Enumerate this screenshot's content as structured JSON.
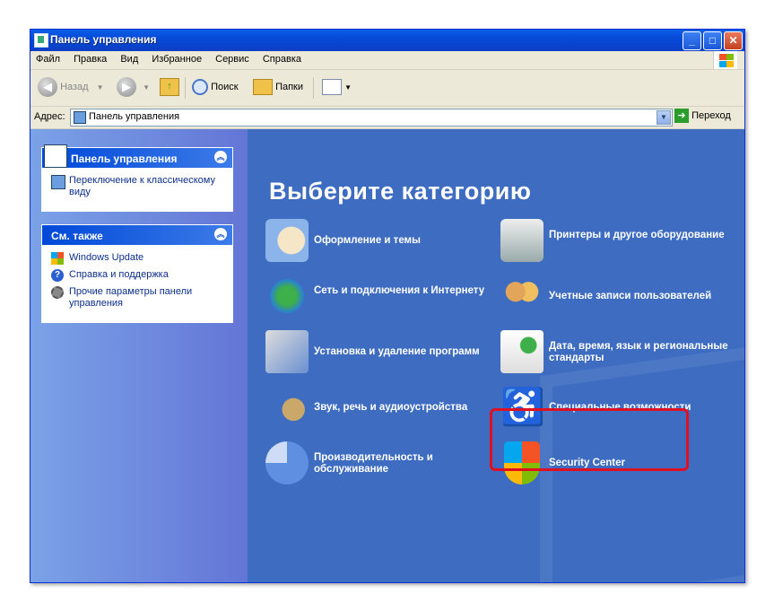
{
  "window": {
    "title": "Панель управления"
  },
  "menu": [
    "Файл",
    "Правка",
    "Вид",
    "Избранное",
    "Сервис",
    "Справка"
  ],
  "toolbar": {
    "back": "Назад",
    "search": "Поиск",
    "folders": "Папки"
  },
  "address": {
    "label": "Адрес:",
    "value": "Панель управления",
    "go": "Переход"
  },
  "left": {
    "panel1": {
      "title": "Панель управления",
      "items": [
        "Переключение к классическому виду"
      ]
    },
    "panel2": {
      "title": "См. также",
      "items": [
        "Windows Update",
        "Справка и поддержка",
        "Прочие параметры панели управления"
      ]
    }
  },
  "main": {
    "title": "Выберите категорию",
    "categories": [
      "Оформление и темы",
      "Принтеры и другое оборудование",
      "Сеть и подключения к Интернету",
      "Учетные записи пользователей",
      "Установка и удаление программ",
      "Дата, время, язык и региональные стандарты",
      "Звук, речь и аудиоустройства",
      "Специальные возможности",
      "Производительность и обслуживание",
      "Security Center"
    ]
  },
  "colors": {
    "pane_blue": "#3d6cc0",
    "highlight_red": "#e01020",
    "title_blue": "#0849d8"
  }
}
